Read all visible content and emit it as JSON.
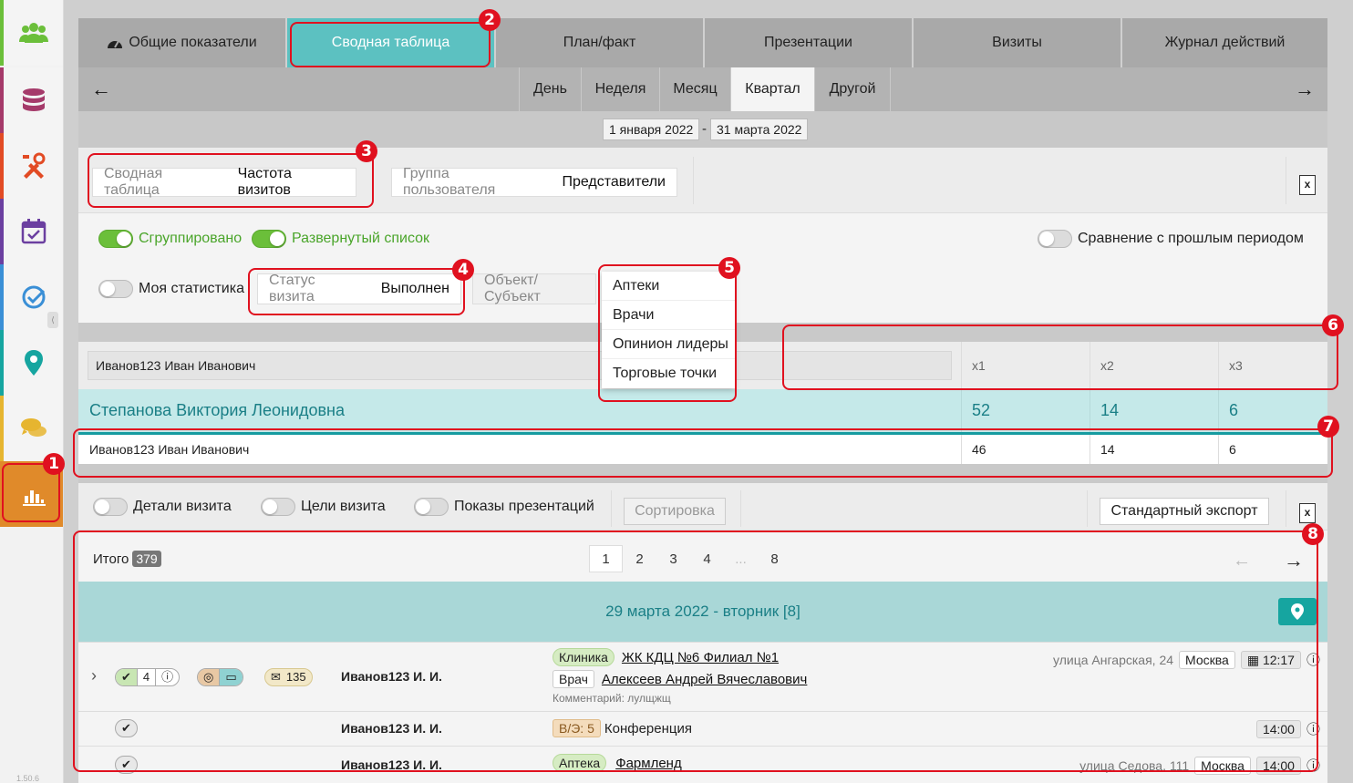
{
  "sidebar": {
    "items": [
      {
        "icon": "users-icon",
        "color": "#6bbf3a"
      },
      {
        "icon": "database-icon",
        "color": "#a53a6a"
      },
      {
        "icon": "tools-icon",
        "color": "#e24b24"
      },
      {
        "icon": "calendar-icon",
        "color": "#6b3fa0"
      },
      {
        "icon": "check-circle-icon",
        "color": "#3a8fd6"
      },
      {
        "icon": "map-pin-icon",
        "color": "#16a5a0"
      },
      {
        "icon": "chat-icon",
        "color": "#e6b530"
      },
      {
        "icon": "chart-icon",
        "color": "#e08a2a"
      }
    ],
    "version": "1.50.6"
  },
  "tabs": [
    "Общие показатели",
    "Сводная таблица",
    "План/факт",
    "Презентации",
    "Визиты",
    "Журнал действий"
  ],
  "periods": [
    "День",
    "Неделя",
    "Месяц",
    "Квартал",
    "Другой"
  ],
  "date_from": "1 января 2022",
  "date_sep": "-",
  "date_to": "31 марта 2022",
  "filters": {
    "table_label": "Сводная таблица",
    "table_value": "Частота визитов",
    "group_label": "Группа пользователя",
    "group_value": "Представители"
  },
  "toggles": {
    "grouped": "Сгруппировано",
    "expanded": "Развернутый список",
    "compare": "Сравнение с прошлым периодом",
    "my_stats": "Моя статистика"
  },
  "status": {
    "label": "Статус визита",
    "value": "Выполнен"
  },
  "object_label": "Объект/Субъект",
  "dropdown": [
    "Аптеки",
    "Врачи",
    "Опинион лидеры",
    "Торговые точки"
  ],
  "summary_table": {
    "filter_value": "Иванов123 Иван Иванович",
    "columns": [
      "x1",
      "x2",
      "x3"
    ],
    "group_row": {
      "name": "Степанова Виктория Леонидовна",
      "values": [
        "52",
        "14",
        "6"
      ]
    },
    "rows": [
      {
        "name": "Иванов123 Иван Иванович",
        "values": [
          "46",
          "14",
          "6"
        ]
      }
    ]
  },
  "details": {
    "visit_details": "Детали визита",
    "visit_goals": "Цели визита",
    "presentations": "Показы презентаций",
    "sort": "Сортировка",
    "export": "Стандартный экспорт"
  },
  "list": {
    "total_label": "Итого",
    "total": "379",
    "pages": [
      "1",
      "2",
      "3",
      "4",
      "...",
      "8"
    ],
    "day_header": "29 марта 2022 - вторник [8]",
    "visits": [
      {
        "check_count": "4",
        "gift_count": "135",
        "user": "Иванов123 И. И.",
        "type": "Клиника",
        "org": "ЖК КДЦ №6 Филиал №1",
        "role": "Врач",
        "person": "Алексеев Андрей Вячеславович",
        "comment": "Комментарий: лулщжщ",
        "address": "улица Ангарская, 24",
        "city": "Москва",
        "time": "12:17"
      },
      {
        "user": "Иванов123 И. И.",
        "type": "В/Э: 5",
        "title": "Конференция",
        "time": "14:00"
      },
      {
        "user": "Иванов123 И. И.",
        "type": "Аптека",
        "org": "Фармленд",
        "address": "улица Седова, 111",
        "city": "Москва",
        "time": "14:00"
      }
    ]
  },
  "annotations": [
    "1",
    "2",
    "3",
    "4",
    "5",
    "6",
    "7",
    "8"
  ]
}
